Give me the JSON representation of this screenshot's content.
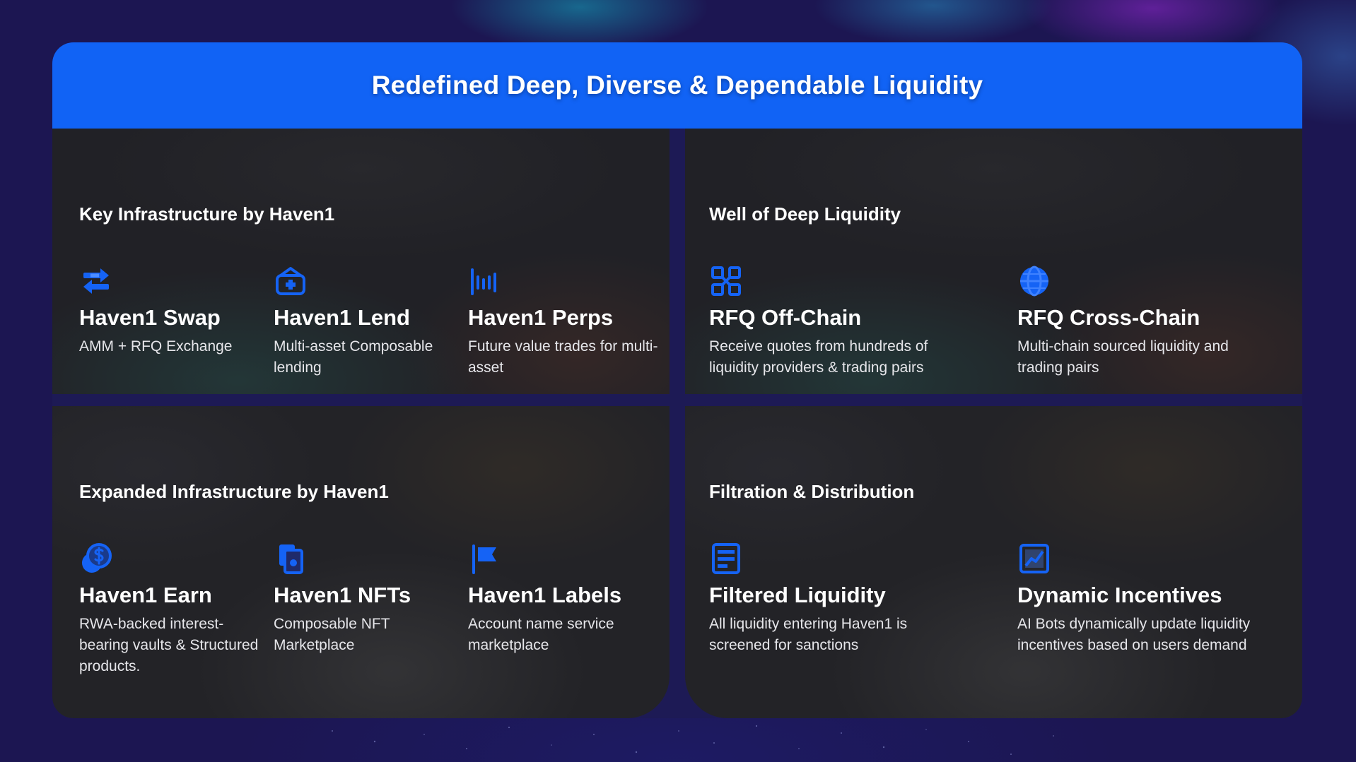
{
  "header": {
    "title": "Redefined Deep, Diverse & Dependable Liquidity"
  },
  "colors": {
    "accent": "#1163f5",
    "background": "#1c1652",
    "panel": "#212126",
    "text": "#ffffff"
  },
  "sections": [
    {
      "title": "Key Infrastructure by Haven1",
      "items": [
        {
          "icon": "swap-arrows-icon",
          "name": "Haven1 Swap",
          "desc": "AMM + RFQ Exchange"
        },
        {
          "icon": "lend-box-icon",
          "name": "Haven1 Lend",
          "desc": "Multi-asset Composable lending"
        },
        {
          "icon": "perps-bars-icon",
          "name": "Haven1 Perps",
          "desc": "Future value trades for multi-asset"
        }
      ]
    },
    {
      "title": "Well of Deep Liquidity",
      "items": [
        {
          "icon": "grid-squares-icon",
          "name": "RFQ Off-Chain",
          "desc": "Receive quotes from hundreds of liquidity providers & trading pairs"
        },
        {
          "icon": "globe-icon",
          "name": "RFQ Cross-Chain",
          "desc": "Multi-chain sourced liquidity and trading pairs"
        }
      ]
    },
    {
      "title": "Expanded Infrastructure by Haven1",
      "items": [
        {
          "icon": "dollar-coins-icon",
          "name": "Haven1 Earn",
          "desc": "RWA-backed interest-bearing vaults & Structured products."
        },
        {
          "icon": "nft-cards-icon",
          "name": "Haven1 NFTs",
          "desc": "Composable NFT Marketplace"
        },
        {
          "icon": "flag-icon",
          "name": "Haven1 Labels",
          "desc": "Account name service marketplace"
        }
      ]
    },
    {
      "title": "Filtration & Distribution",
      "items": [
        {
          "icon": "document-filter-icon",
          "name": "Filtered Liquidity",
          "desc": "All liquidity entering Haven1 is screened for sanctions"
        },
        {
          "icon": "chart-trend-icon",
          "name": "Dynamic Incentives",
          "desc": "AI Bots dynamically update liquidity incentives based on users demand"
        }
      ]
    }
  ]
}
